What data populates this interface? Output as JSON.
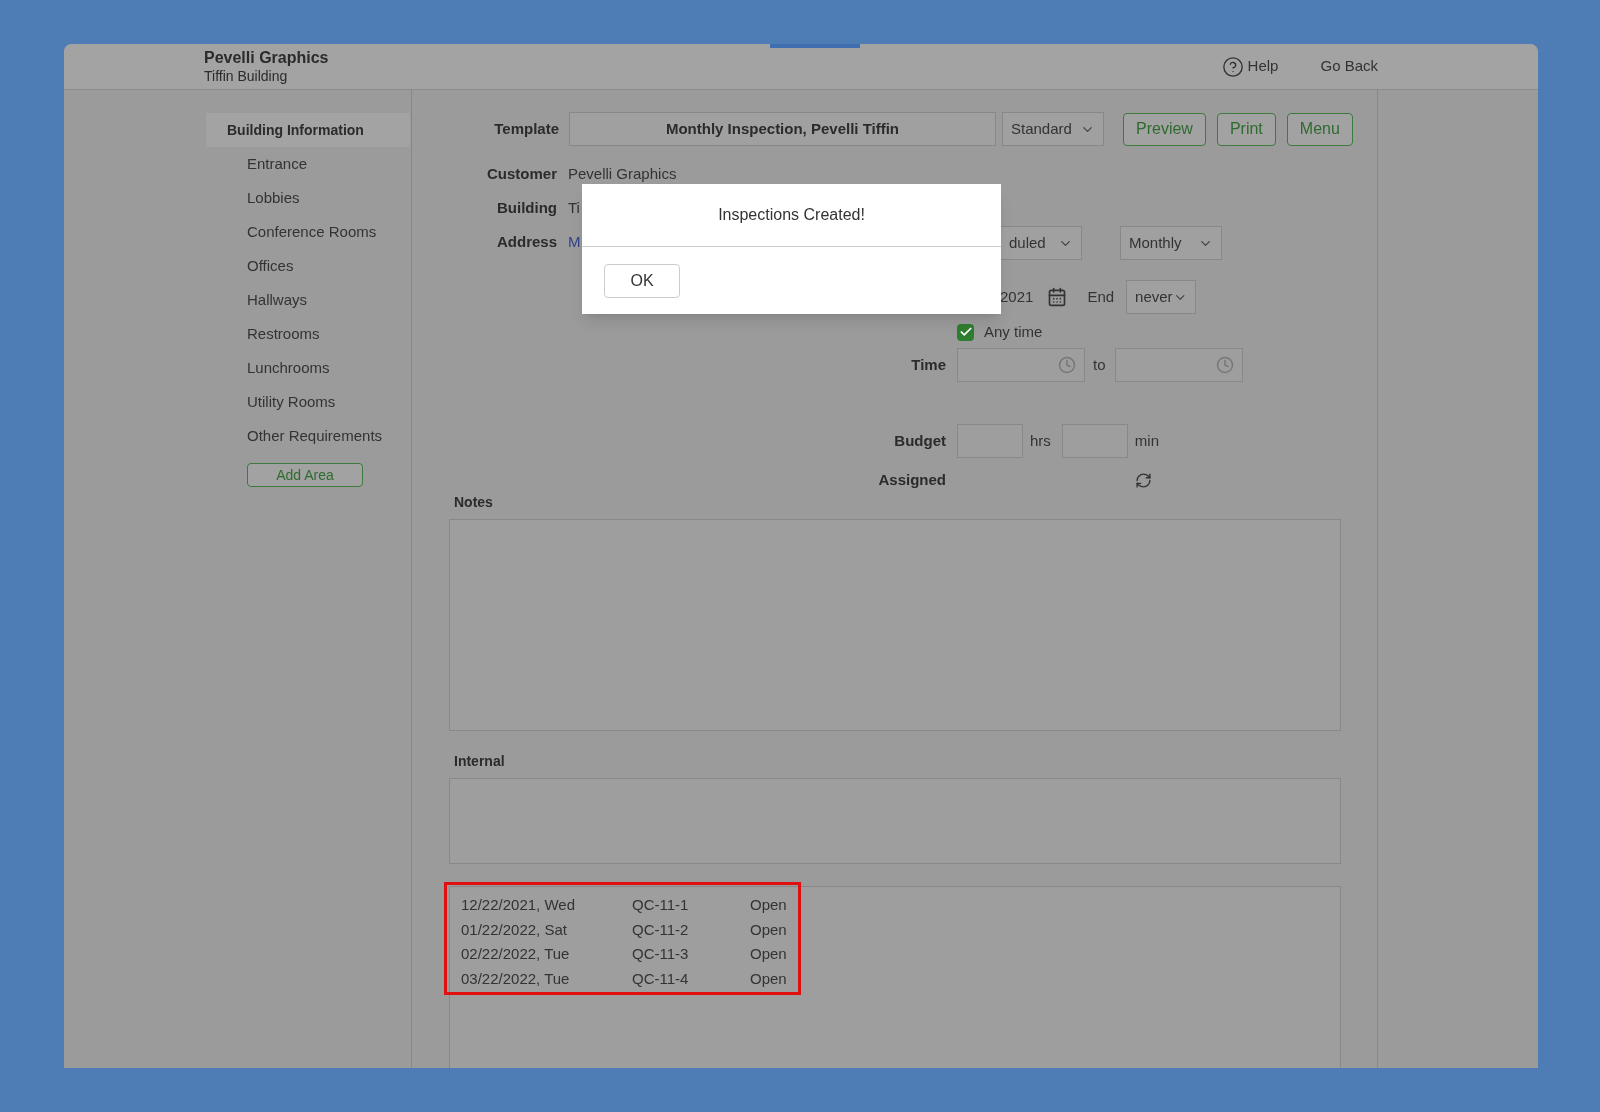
{
  "header": {
    "title": "Pevelli Graphics",
    "subtitle": "Tiffin Building",
    "links": [
      {
        "label": "Help",
        "kind": "help"
      },
      {
        "label": "Go Back",
        "kind": "plain"
      }
    ]
  },
  "sidebar": {
    "items": [
      {
        "label": "Building Information",
        "selected": true
      },
      {
        "label": "Entrance",
        "selected": false
      },
      {
        "label": "Lobbies",
        "selected": false
      },
      {
        "label": "Conference Rooms",
        "selected": false
      },
      {
        "label": "Offices",
        "selected": false
      },
      {
        "label": "Hallways",
        "selected": false
      },
      {
        "label": "Restrooms",
        "selected": false
      },
      {
        "label": "Lunchrooms",
        "selected": false
      },
      {
        "label": "Utility Rooms",
        "selected": false
      },
      {
        "label": "Other Requirements",
        "selected": false
      }
    ],
    "add_button": "Add Area"
  },
  "template": {
    "label": "Template",
    "value": "Monthly Inspection, Pevelli Tiffin",
    "type_select": "Standard",
    "buttons": [
      "Preview",
      "Print",
      "Menu"
    ]
  },
  "info": [
    {
      "label": "Customer",
      "value": "Pevelli Graphics",
      "kind": "text"
    },
    {
      "label": "Building",
      "value": "Ti",
      "kind": "text"
    },
    {
      "label": "Address",
      "value": "M",
      "kind": "link"
    }
  ],
  "schedule": {
    "status_select": "duled",
    "frequency_select": "Monthly",
    "start_date": "2021",
    "end_label": "End",
    "end_select": "never",
    "any_time": {
      "label": "Any time",
      "checked": true
    },
    "time": {
      "label": "Time",
      "separator": "to"
    },
    "budget": {
      "label": "Budget",
      "hours_unit": "hrs",
      "minutes_unit": "min"
    },
    "assigned_label": "Assigned"
  },
  "notes": {
    "label": "Notes"
  },
  "internal": {
    "label": "Internal"
  },
  "inspections": [
    {
      "date": "12/22/2021, Wed",
      "code": "QC-11-1",
      "status": "Open"
    },
    {
      "date": "01/22/2022, Sat",
      "code": "QC-11-2",
      "status": "Open"
    },
    {
      "date": "02/22/2022, Tue",
      "code": "QC-11-3",
      "status": "Open"
    },
    {
      "date": "03/22/2022, Tue",
      "code": "QC-11-4",
      "status": "Open"
    }
  ],
  "dialog": {
    "message": "Inspections Created!",
    "button": "OK"
  }
}
